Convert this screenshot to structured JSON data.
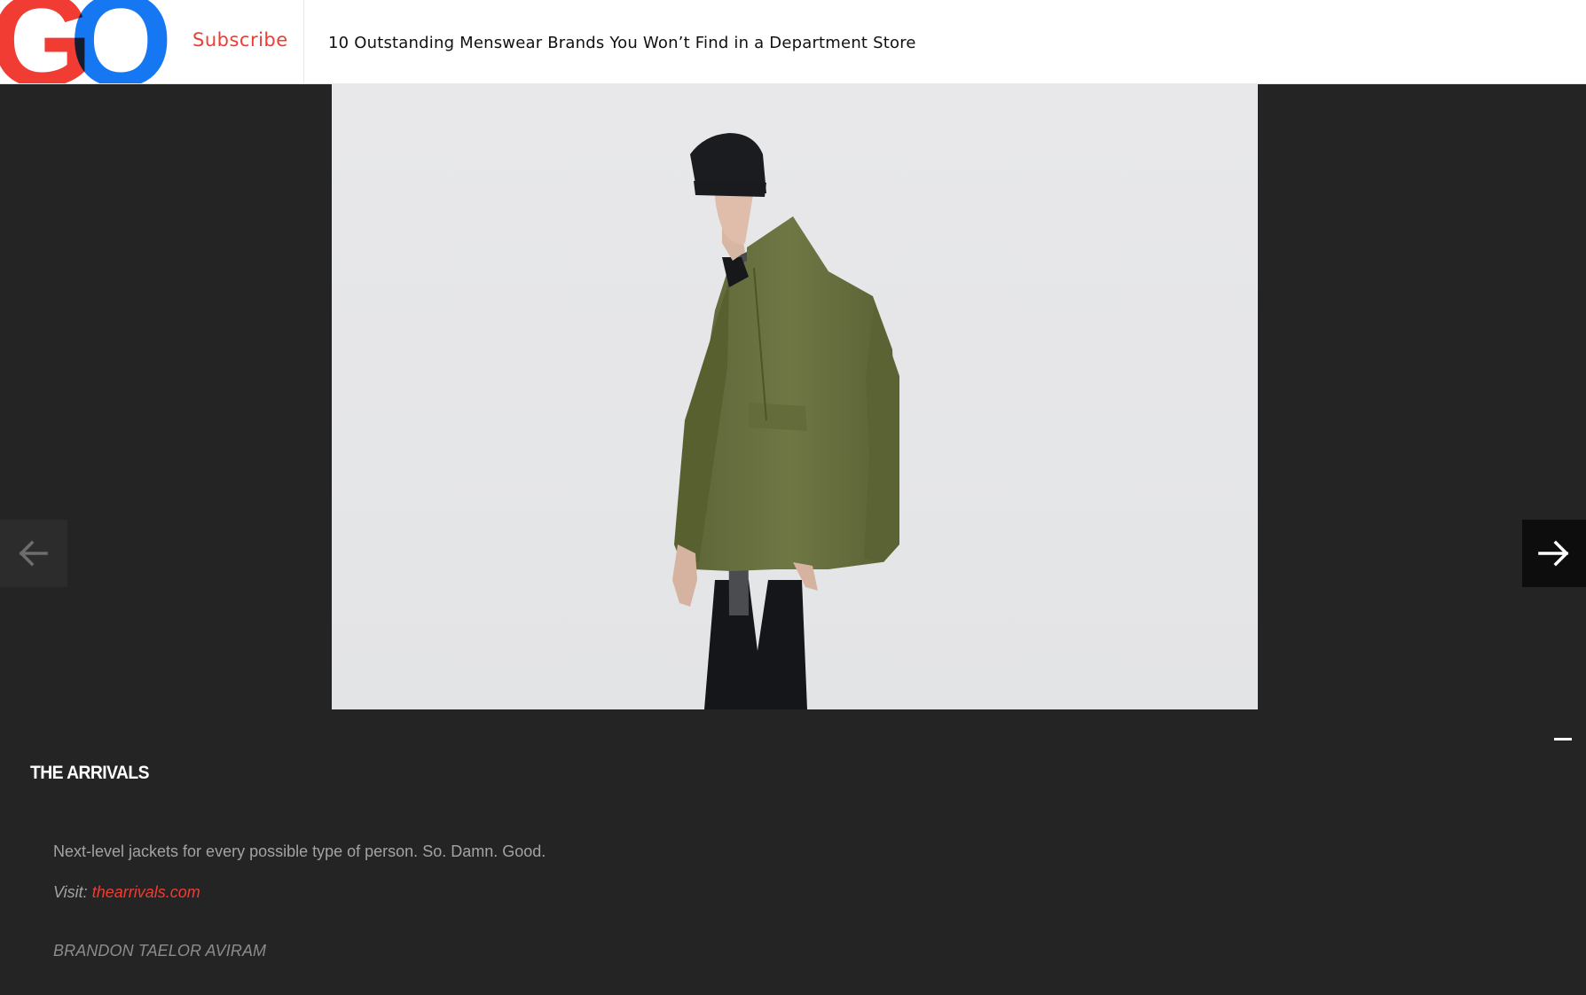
{
  "header": {
    "logo_g": "G",
    "logo_q": "Q",
    "subscribe_label": "Subscribe",
    "article_title": "10 Outstanding Menswear Brands You Won’t Find in a Department Store"
  },
  "colors": {
    "brand_red": "#f03c32",
    "brand_blue": "#1577f2",
    "link_red": "#f03c32",
    "background": "#242424"
  },
  "gallery": {
    "prev_icon": "arrow-left-icon",
    "next_icon": "arrow-right-icon",
    "collapse_icon": "minus-icon"
  },
  "caption": {
    "title": "THE ARRIVALS",
    "description": "Next-level jackets for every possible type of person. So. Damn. Good.",
    "visit_label": "Visit: ",
    "visit_link": "thearrivals.com",
    "credit": "BRANDON TAELOR AVIRAM"
  }
}
